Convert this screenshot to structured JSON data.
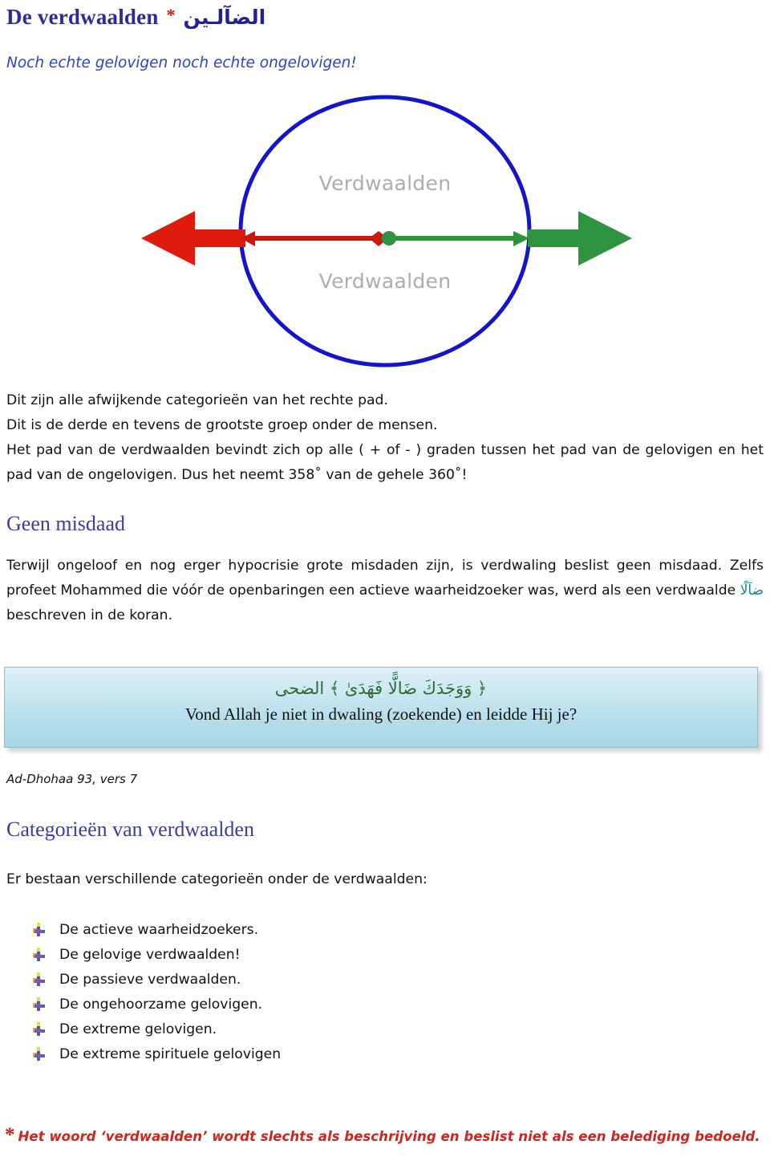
{
  "title": {
    "main": "De verdwaalden",
    "asterisk": "*",
    "arabic": "الضآلـين"
  },
  "subtitle": "Noch echte gelovigen noch echte ongelovigen!",
  "diagram": {
    "label_top": "Verdwaalden",
    "label_bottom": "Verdwaalden",
    "ellipse_color": "#1414cc",
    "left_arrow_color": "#e01b0c",
    "right_arrow_color": "#2e9440",
    "label_color": "#adadad"
  },
  "intro": {
    "line1": "Dit zijn alle afwijkende categorieën van het rechte pad.",
    "line2": "Dit is de derde en tevens de grootste groep onder de mensen.",
    "line3": "Het pad van de verdwaalden bevindt zich op alle ( + of - ) graden tussen het pad van de gelovigen en het pad van de ongelovigen. Dus het neemt 358˚ van de gehele 360˚!"
  },
  "section_geen_misdaad": {
    "heading": "Geen misdaad",
    "body_part1": "Terwijl ongeloof en nog erger hypocrisie grote misdaden zijn, is verdwaling beslist geen misdaad. Zelfs profeet Mohammed die vóór de openbaringen een actieve waarheidzoeker was, werd als een verdwaalde ",
    "arabic_word": "ضآلًا",
    "body_part2": " beschreven in de koran.",
    "arabic_word_color": "#1a7f96"
  },
  "quote": {
    "arabic": "﴿ وَوَجَدَكَ ضَالًّا فَهَدَىٰ ﴾ الضحى",
    "dutch": "Vond Allah je niet in dwaling (zoekende) en leidde Hij je?",
    "caption": "Ad-Dhohaa 93, vers 7",
    "arabic_color": "#2c6b35",
    "box_border_color": "#9fb9c4"
  },
  "section_categorieen": {
    "heading": "Categorieën van verdwaalden",
    "lead": "Er bestaan verschillende categorieën onder de verdwaalden:",
    "items": [
      {
        "label": "De actieve waarheidzoekers."
      },
      {
        "label": "De gelovige verdwaalden!"
      },
      {
        "label": "De passieve verdwaalden."
      },
      {
        "label": "De ongehoorzame gelovigen."
      },
      {
        "label": "De extreme gelovigen."
      },
      {
        "label": "De extreme spirituele gelovigen"
      }
    ],
    "bullet_icon": "multicolor-cross-bullet-icon"
  },
  "footer": {
    "asterisk": "*",
    "note": "Het woord ‘verdwaalden’ wordt slechts als beschrijving en beslist niet als een belediging bedoeld.",
    "color": "#d3241c"
  },
  "theme": {
    "heading_blue": "#3b3bb0",
    "title_blue": "#2b2b9c",
    "subtitle_blue": "#2b45c8",
    "red": "#d01b12"
  }
}
